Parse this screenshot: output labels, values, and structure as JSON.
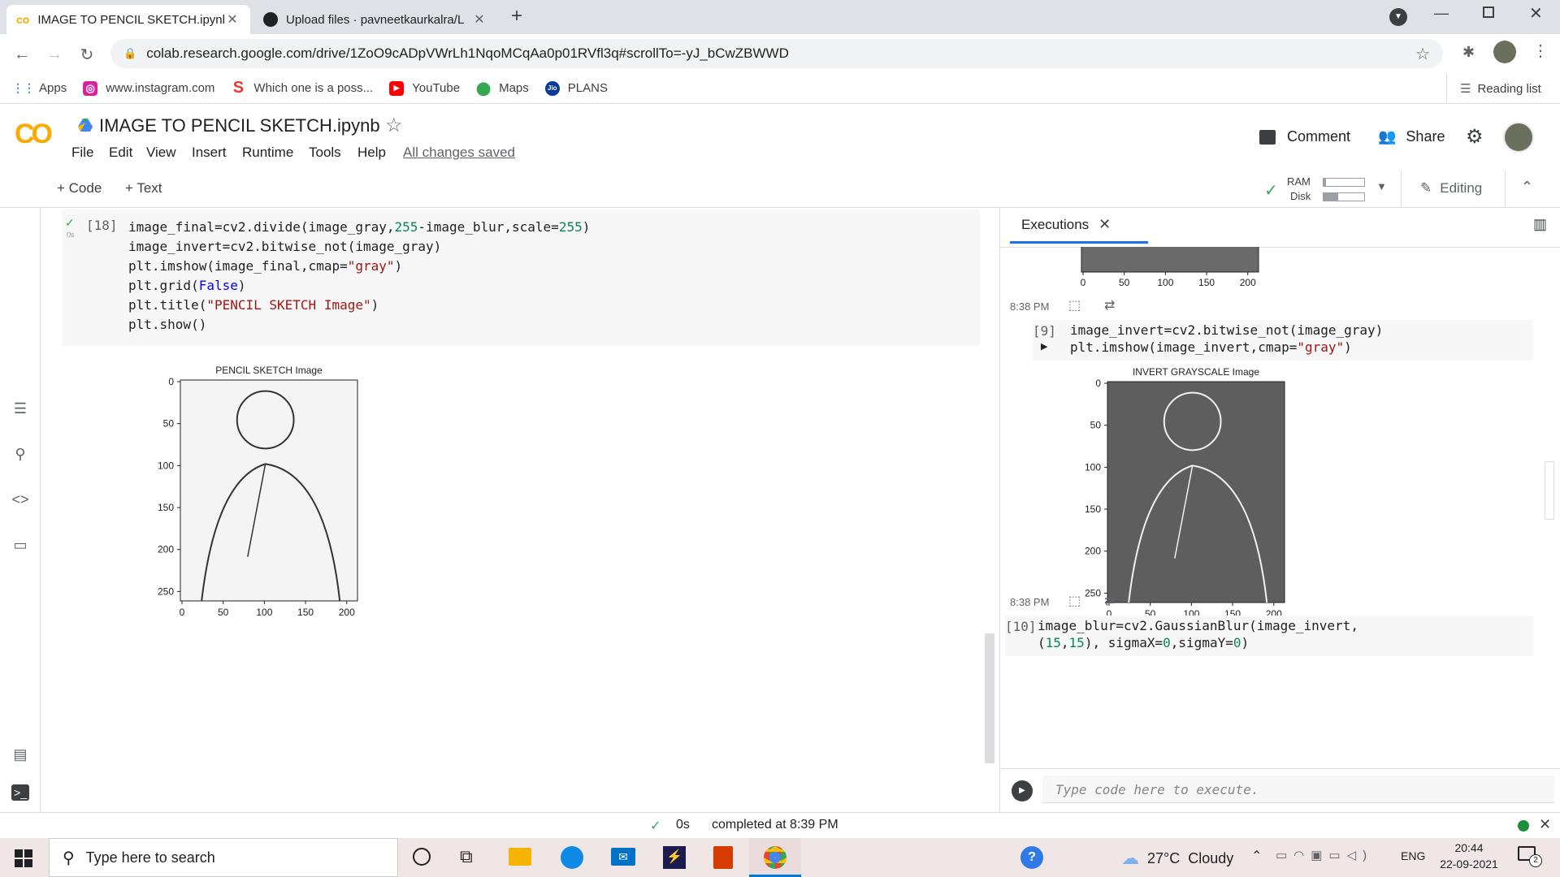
{
  "browser": {
    "tabs": [
      {
        "title": "IMAGE TO PENCIL SKETCH.ipynb",
        "favicon": "colab-icon",
        "active": true
      },
      {
        "title": "Upload files · pavneetkaurkalra/L",
        "favicon": "github-icon",
        "active": false
      }
    ],
    "new_tab": "+",
    "url": "colab.research.google.com/drive/1ZoO9cADpVWrLh1NqoMCqAa0p01RVfl3q#scrollTo=-yJ_bCwZBWWD",
    "bookmarks": [
      {
        "label": "Apps",
        "icon": "apps-grid-icon"
      },
      {
        "label": "www.instagram.com",
        "icon": "instagram-icon"
      },
      {
        "label": "Which one is a poss...",
        "icon": "s-icon"
      },
      {
        "label": "YouTube",
        "icon": "youtube-icon"
      },
      {
        "label": "Maps",
        "icon": "maps-icon"
      },
      {
        "label": "PLANS",
        "icon": "jio-icon"
      }
    ],
    "reading_list": "Reading list"
  },
  "colab": {
    "logo": "CO",
    "notebook_title": "IMAGE TO PENCIL SKETCH.ipynb",
    "menu": [
      "File",
      "Edit",
      "View",
      "Insert",
      "Runtime",
      "Tools",
      "Help"
    ],
    "save_status": "All changes saved",
    "comment": "Comment",
    "share": "Share",
    "add_code": "+ Code",
    "add_text": "+ Text",
    "ram": "RAM",
    "disk": "Disk",
    "ram_usage": 0.05,
    "disk_usage": 0.35,
    "editing": "Editing"
  },
  "cell": {
    "exec_count": "[18]",
    "exec_time": "0s",
    "code": [
      [
        {
          "t": "image_final=cv2.divide(image_gray,"
        },
        {
          "t": "255",
          "c": "num"
        },
        {
          "t": "-image_blur,scale="
        },
        {
          "t": "255",
          "c": "num"
        },
        {
          "t": ")"
        }
      ],
      [
        {
          "t": "image_invert=cv2.bitwise_not(image_gray)"
        }
      ],
      [
        {
          "t": "plt.imshow(image_final,cmap="
        },
        {
          "t": "\"gray\"",
          "c": "str"
        },
        {
          "t": ")"
        }
      ],
      [
        {
          "t": "plt.grid("
        },
        {
          "t": "False",
          "c": "kw"
        },
        {
          "t": ")"
        }
      ],
      [
        {
          "t": "plt.title("
        },
        {
          "t": "\"PENCIL SKETCH Image\"",
          "c": "str"
        },
        {
          "t": ")"
        }
      ],
      [
        {
          "t": "plt.show()"
        }
      ]
    ],
    "plot": {
      "title": "PENCIL SKETCH Image",
      "yticks": [
        "0",
        "50",
        "100",
        "150",
        "200",
        "250"
      ],
      "xticks": [
        "0",
        "50",
        "100",
        "150",
        "200"
      ]
    }
  },
  "executions": {
    "tab_label": "Executions",
    "top_plot_xticks": [
      "0",
      "50",
      "100",
      "150",
      "200"
    ],
    "entries": [
      {
        "time": "8:38 PM",
        "count": "[9]",
        "code": [
          [
            {
              "t": "image_invert=cv2.bitwise_not(image_gray)"
            }
          ],
          [
            {
              "t": "plt.imshow(image_invert,cmap="
            },
            {
              "t": "\"gray\"",
              "c": "str"
            },
            {
              "t": ")"
            }
          ]
        ],
        "plot_title": "INVERT GRAYSCALE Image",
        "yticks": [
          "0",
          "50",
          "100",
          "150",
          "200",
          "250"
        ],
        "xticks": [
          "0",
          "50",
          "100",
          "150",
          "200"
        ]
      },
      {
        "time": "8:38 PM",
        "count": "[10]",
        "code": [
          [
            {
              "t": "image_blur=cv2.GaussianBlur(image_invert,"
            }
          ],
          [
            {
              "t": "("
            },
            {
              "t": "15",
              "c": "num"
            },
            {
              "t": ","
            },
            {
              "t": "15",
              "c": "num"
            },
            {
              "t": "), sigmaX="
            },
            {
              "t": "0",
              "c": "num"
            },
            {
              "t": ",sigmaY="
            },
            {
              "t": "0",
              "c": "num"
            },
            {
              "t": ")"
            }
          ]
        ]
      }
    ],
    "input_placeholder": "Type code here to execute."
  },
  "status": {
    "time": "0s",
    "message": "completed at 8:39 PM"
  },
  "taskbar": {
    "search_placeholder": "Type here to search",
    "weather": "27°C  Cloudy",
    "lang": "ENG",
    "clock_time": "20:44",
    "clock_date": "22-09-2021",
    "notification_count": "2"
  }
}
